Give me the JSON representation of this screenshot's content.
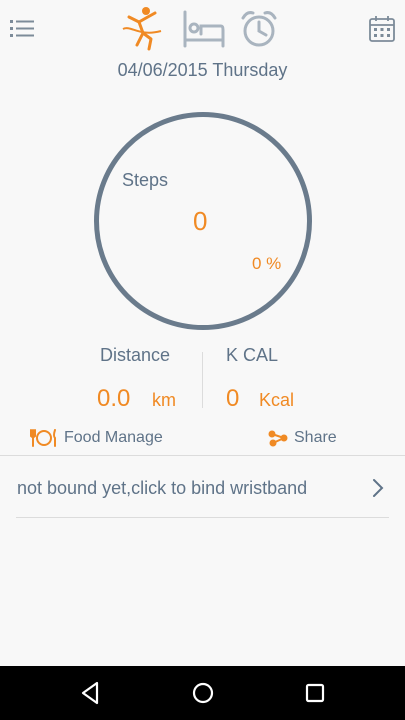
{
  "header": {
    "date_text": "04/06/2015 Thursday",
    "icons": [
      "menu-list-icon",
      "walking-person-icon",
      "bed-sleep-icon",
      "alarm-clock-icon",
      "calendar-icon"
    ],
    "active_tab": "walking"
  },
  "steps": {
    "label": "Steps",
    "value": "0",
    "percent": "0 %"
  },
  "stats": {
    "distance_label": "Distance",
    "distance_value": "0.0",
    "distance_unit": "km",
    "kcal_label": "K CAL",
    "kcal_value": "0",
    "kcal_unit": "Kcal"
  },
  "actions": {
    "food_label": "Food Manage",
    "share_label": "Share"
  },
  "bind": {
    "text": "not bound yet,click to bind wristband"
  },
  "colors": {
    "accent": "#f08a24",
    "text": "#5f7388",
    "ring": "#6a7b8c",
    "icon_inactive": "#a9b4bf"
  }
}
